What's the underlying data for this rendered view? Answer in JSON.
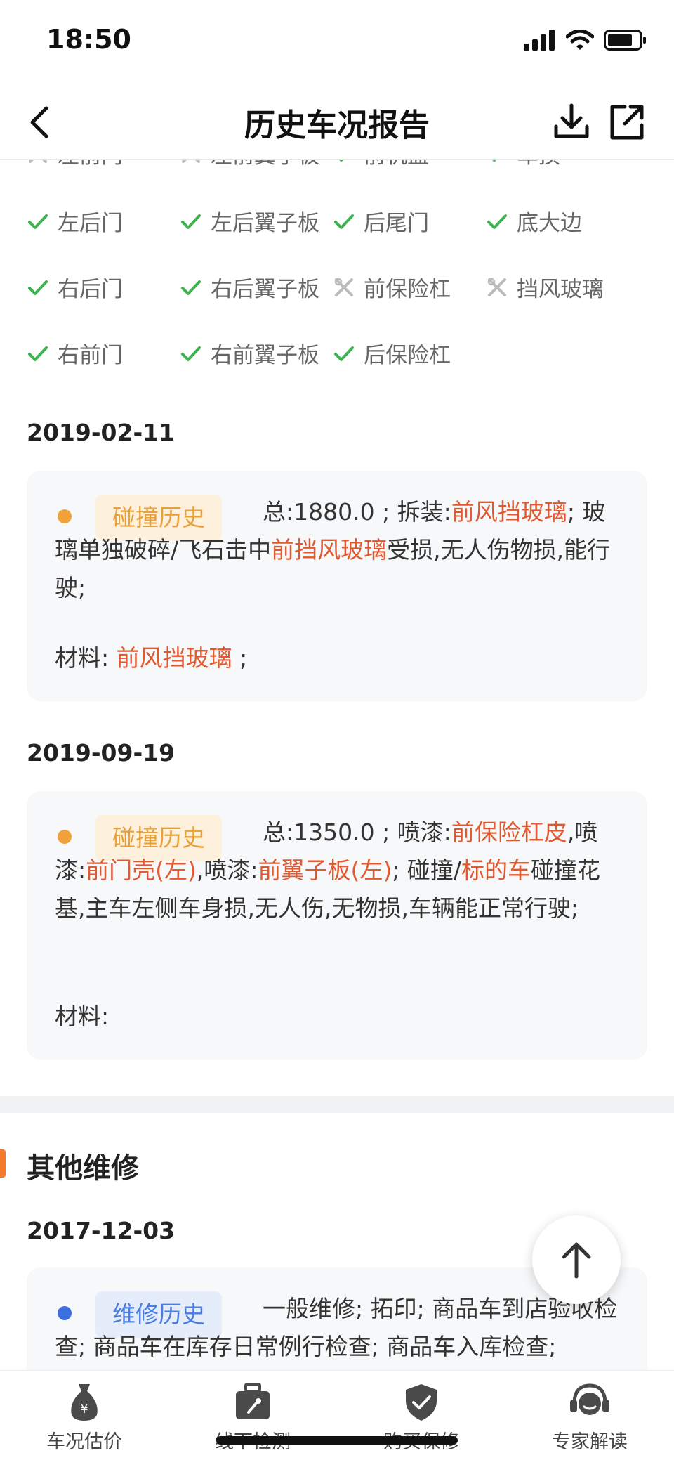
{
  "status_bar": {
    "time": "18:50"
  },
  "nav": {
    "title": "历史车况报告"
  },
  "parts": {
    "row0": [
      "左前门",
      "左前翼子板",
      "前机盖",
      "车损"
    ],
    "row1": [
      "左后门",
      "左后翼子板",
      "后尾门",
      "底大边"
    ],
    "row2": [
      "右后门",
      "右后翼子板",
      "前保险杠",
      "挡风玻璃"
    ],
    "row3": [
      "右前门",
      "右前翼子板",
      "后保险杠"
    ]
  },
  "records": [
    {
      "date": "2019-02-11",
      "badge": "碰撞历史",
      "segments": [
        {
          "t": "总:1880.0 ; 拆装:",
          "hl": false
        },
        {
          "t": "前风挡玻璃",
          "hl": true
        },
        {
          "t": "; 玻璃单独破碎/飞石击中",
          "hl": false
        },
        {
          "t": "前挡风玻璃",
          "hl": true
        },
        {
          "t": "受损,无人伤物损,能行驶;",
          "hl": false
        }
      ],
      "material_label": "材料: ",
      "material_item": "前风挡玻璃",
      "material_suffix": " ;"
    },
    {
      "date": "2019-09-19",
      "badge": "碰撞历史",
      "segments": [
        {
          "t": "总:1350.0 ; 喷漆:",
          "hl": false
        },
        {
          "t": "前保险杠皮",
          "hl": true
        },
        {
          "t": ",喷漆:",
          "hl": false
        },
        {
          "t": "前门壳(左)",
          "hl": true
        },
        {
          "t": ",喷漆:",
          "hl": false
        },
        {
          "t": "前翼子板(左)",
          "hl": true
        },
        {
          "t": "; 碰撞/",
          "hl": false
        },
        {
          "t": "标的车",
          "hl": true
        },
        {
          "t": "碰撞花基,主车左侧车身损,无人伤,无物损,车辆能正常行驶;",
          "hl": false
        }
      ],
      "material_label": "材料:"
    }
  ],
  "other_repairs": {
    "title": "其他维修",
    "date": "2017-12-03",
    "badge": "维修历史",
    "text": "一般维修; 拓印; 商品车到店验收检查; 商品车在库存日常例行检查; 商品车入库检查;"
  },
  "tabs": [
    {
      "label": "车况估价"
    },
    {
      "label": "线下检测"
    },
    {
      "label": "购买保修"
    },
    {
      "label": "专家解读"
    }
  ],
  "colors": {
    "check": "#3fb24f",
    "highlight": "#e2582f",
    "orange_dot": "#f2a23a",
    "blue_dot": "#3d6fe0"
  }
}
